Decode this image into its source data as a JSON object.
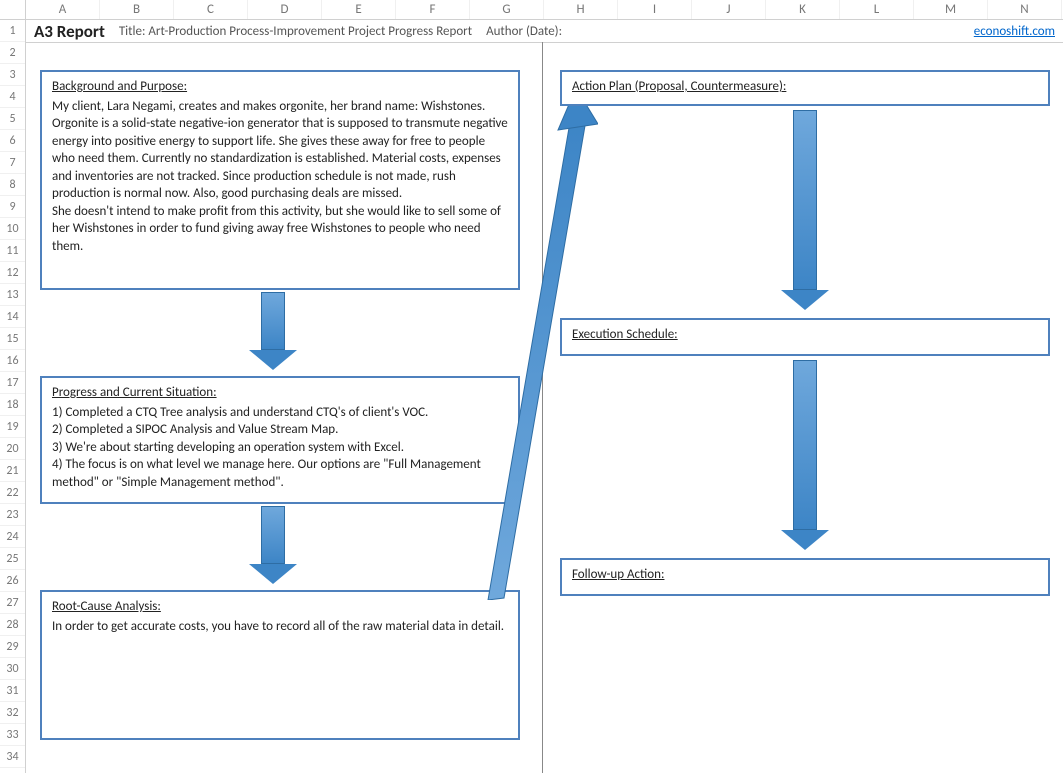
{
  "columns": [
    "A",
    "B",
    "C",
    "D",
    "E",
    "F",
    "G",
    "H",
    "I",
    "J",
    "K",
    "L",
    "M",
    "N"
  ],
  "rows": [
    "1",
    "2",
    "3",
    "4",
    "5",
    "6",
    "7",
    "8",
    "9",
    "10",
    "11",
    "12",
    "13",
    "14",
    "15",
    "16",
    "17",
    "18",
    "19",
    "20",
    "21",
    "22",
    "23",
    "24",
    "25",
    "26",
    "27",
    "28",
    "29",
    "30",
    "31",
    "32",
    "33",
    "34"
  ],
  "header": {
    "report_label": "A3 Report",
    "title_label": "Title: Art-Production Process-Improvement Project Progress Report",
    "author_label": "Author (Date):",
    "link_text": "econoshift.com"
  },
  "boxes": {
    "background": {
      "title": "Background and Purpose:",
      "body": "My client, Lara Negami, creates and makes orgonite, her brand name: Wishstones.  Orgonite is a solid-state negative-ion generator that is supposed to transmute negative energy into positive energy to support life.  She gives these away for free to people who need them.  Currently no standardization is established.  Material costs, expenses and inventories are not tracked.  Since production schedule is not made, rush production is normal now.  Also, good purchasing deals are missed.\nShe doesn't intend to make profit from this activity, but she would like to sell some of her Wishstones in order to fund giving away free Wishstones to people who need them."
    },
    "progress": {
      "title": "Progress and Current Situation:",
      "body": "1) Completed a CTQ Tree analysis and understand CTQ's of client's VOC.\n2) Completed a SIPOC Analysis and Value Stream Map.\n3) We're about starting developing an operation system with Excel.\n4) The focus is on what level we manage here.  Our options are \"Full Management method\" or \"Simple Management method\"."
    },
    "rootcause": {
      "title": "Root-Cause Analysis:",
      "body": "In order to get accurate costs, you have to record all of the raw material data in detail."
    },
    "actionplan": {
      "title": "Action Plan (Proposal, Countermeasure):"
    },
    "schedule": {
      "title": "Execution Schedule:"
    },
    "followup": {
      "title": "Follow-up Action:"
    }
  }
}
